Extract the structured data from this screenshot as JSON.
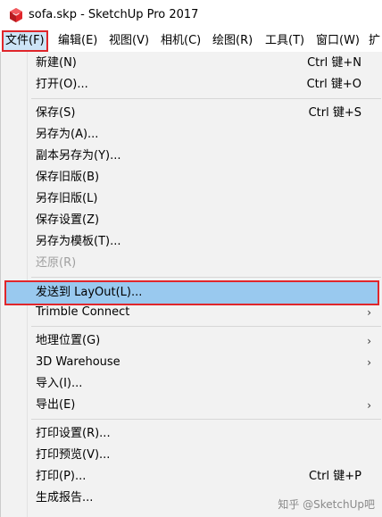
{
  "window": {
    "title": "sofa.skp - SketchUp Pro 2017",
    "app_icon": "sketchup-logo-icon",
    "accent_color": "#e0262b"
  },
  "menubar": [
    {
      "label": "文件(F)",
      "active": true
    },
    {
      "label": "编辑(E)"
    },
    {
      "label": "视图(V)"
    },
    {
      "label": "相机(C)"
    },
    {
      "label": "绘图(R)"
    },
    {
      "label": "工具(T)"
    },
    {
      "label": "窗口(W)"
    },
    {
      "label": "扩"
    }
  ],
  "file_menu": {
    "items": [
      {
        "label": "新建(N)",
        "shortcut": "Ctrl 键+N"
      },
      {
        "label": "打开(O)...",
        "shortcut": "Ctrl 键+O"
      },
      {
        "label": "保存(S)",
        "shortcut": "Ctrl 键+S"
      },
      {
        "label": "另存为(A)..."
      },
      {
        "label": "副本另存为(Y)..."
      },
      {
        "label": "保存旧版(B)"
      },
      {
        "label": "另存旧版(L)"
      },
      {
        "label": "保存设置(Z)"
      },
      {
        "label": "另存为模板(T)..."
      },
      {
        "label": "还原(R)",
        "disabled": true
      },
      {
        "label": "发送到 LayOut(L)...",
        "highlighted": true
      },
      {
        "label": "Trimble Connect",
        "submenu": "›"
      },
      {
        "label": "地理位置(G)",
        "submenu": "›"
      },
      {
        "label": "3D Warehouse",
        "submenu": "›"
      },
      {
        "label": "导入(I)..."
      },
      {
        "label": "导出(E)",
        "submenu": "›"
      },
      {
        "label": "打印设置(R)..."
      },
      {
        "label": "打印预览(V)..."
      },
      {
        "label": "打印(P)...",
        "shortcut": "Ctrl 键+P"
      },
      {
        "label": "生成报告..."
      }
    ]
  },
  "watermark": "知乎 @SketchUp吧"
}
